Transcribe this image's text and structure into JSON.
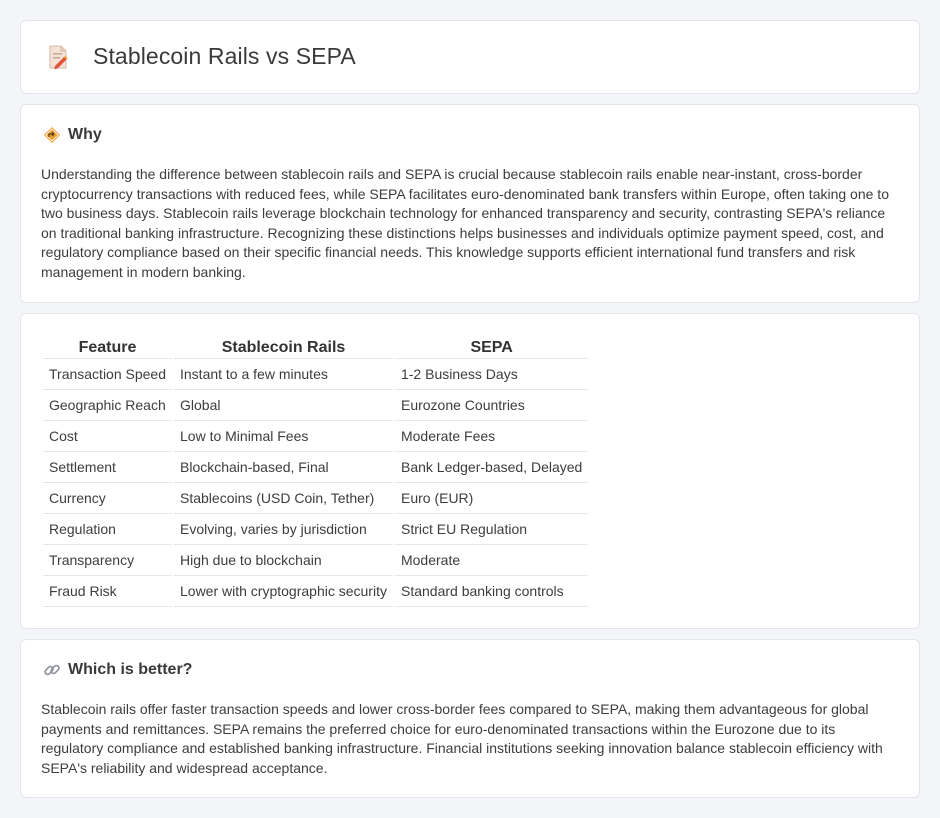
{
  "header": {
    "title": "Stablecoin Rails vs SEPA",
    "icon": "document-pencil-icon"
  },
  "why": {
    "icon": "road-sign-icon",
    "heading": "Why",
    "text": "Understanding the difference between stablecoin rails and SEPA is crucial because stablecoin rails enable near-instant, cross-border cryptocurrency transactions with reduced fees, while SEPA facilitates euro-denominated bank transfers within Europe, often taking one to two business days. Stablecoin rails leverage blockchain technology for enhanced transparency and security, contrasting SEPA's reliance on traditional banking infrastructure. Recognizing these distinctions helps businesses and individuals optimize payment speed, cost, and regulatory compliance based on their specific financial needs. This knowledge supports efficient international fund transfers and risk management in modern banking."
  },
  "comparison": {
    "headers": [
      "Feature",
      "Stablecoin Rails",
      "SEPA"
    ],
    "rows": [
      [
        "Transaction Speed",
        "Instant to a few minutes",
        "1-2 Business Days"
      ],
      [
        "Geographic Reach",
        "Global",
        "Eurozone Countries"
      ],
      [
        "Cost",
        "Low to Minimal Fees",
        "Moderate Fees"
      ],
      [
        "Settlement",
        "Blockchain-based, Final",
        "Bank Ledger-based, Delayed"
      ],
      [
        "Currency",
        "Stablecoins (USD Coin, Tether)",
        "Euro (EUR)"
      ],
      [
        "Regulation",
        "Evolving, varies by jurisdiction",
        "Strict EU Regulation"
      ],
      [
        "Transparency",
        "High due to blockchain",
        "Moderate"
      ],
      [
        "Fraud Risk",
        "Lower with cryptographic security",
        "Standard banking controls"
      ]
    ]
  },
  "better": {
    "icon": "link-icon",
    "heading": "Which is better?",
    "text": "Stablecoin rails offer faster transaction speeds and lower cross-border fees compared to SEPA, making them advantageous for global payments and remittances. SEPA remains the preferred choice for euro-denominated transactions within the Eurozone due to its regulatory compliance and established banking infrastructure. Financial institutions seeking innovation balance stablecoin efficiency with SEPA's reliability and widespread acceptance."
  },
  "colors": {
    "background": "#f4f5f9",
    "card": "#ffffff",
    "border": "#e3e5ea",
    "icon_orange": "#f0a030",
    "icon_red": "#e0523a"
  }
}
